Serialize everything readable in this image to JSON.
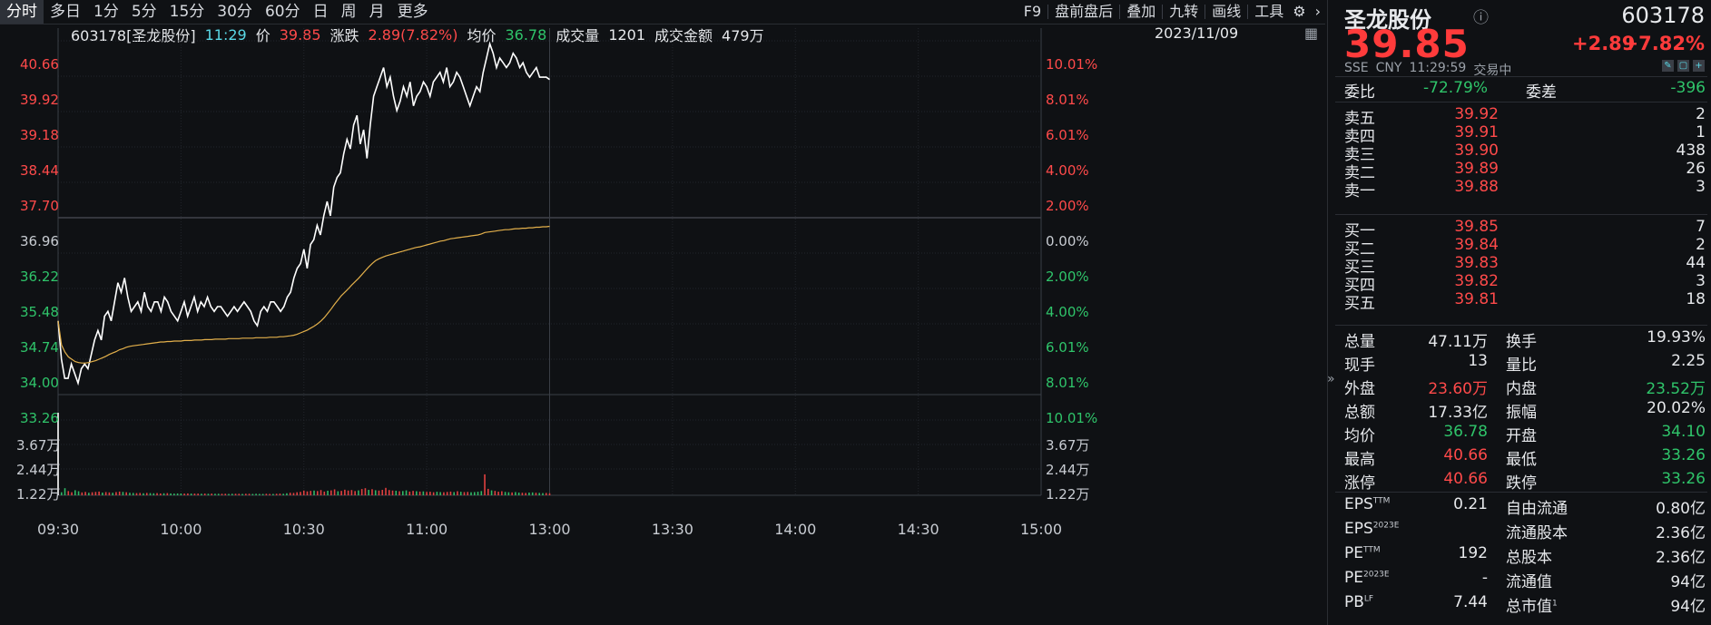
{
  "toolbar": {
    "periods": [
      "分时",
      "多日",
      "1分",
      "5分",
      "15分",
      "30分",
      "60分",
      "日",
      "周",
      "月",
      "更多"
    ],
    "active": "分时",
    "right_items": [
      "F9",
      "盘前盘后",
      "叠加",
      "九转",
      "画线",
      "工具"
    ],
    "settings_icon": "gear-icon",
    "more_icon": "chevron-right-icon"
  },
  "info": {
    "code_name": "603178[圣龙股份]",
    "time": "11:29",
    "price_label": "价",
    "price": "39.85",
    "change_label": "涨跌",
    "change": "2.89(7.82%)",
    "avg_label": "均价",
    "avg": "36.78",
    "vol_label": "成交量",
    "vol": "1201",
    "amount_label": "成交金额",
    "amount": "479万",
    "date": "2023/11/09"
  },
  "chart_data": {
    "type": "line",
    "prev_close": 36.96,
    "ylim": [
      33.26,
      40.66
    ],
    "y_ticks": [
      "40.66",
      "39.92",
      "39.18",
      "38.44",
      "37.70",
      "36.96",
      "36.22",
      "35.48",
      "34.74",
      "34.00",
      "33.26"
    ],
    "pct_ticks": [
      "10.01%",
      "8.01%",
      "6.01%",
      "4.00%",
      "2.00%",
      "0.00%",
      "2.00%",
      "4.00%",
      "6.01%",
      "8.01%",
      "10.01%"
    ],
    "x_ticks": [
      "09:30",
      "10:00",
      "10:30",
      "11:00",
      "13:00",
      "13:30",
      "14:00",
      "14:30",
      "15:00"
    ],
    "vol_ticks": [
      "3.67万",
      "2.44万",
      "1.22万"
    ],
    "vol_max": 48900,
    "series": [
      {
        "color": "#ffffff",
        "values": [
          34.8,
          34.0,
          33.6,
          33.6,
          33.9,
          33.7,
          33.5,
          33.8,
          33.9,
          33.8,
          34.1,
          34.4,
          34.6,
          34.4,
          34.9,
          35.0,
          34.8,
          35.2,
          35.6,
          35.4,
          35.7,
          35.3,
          35.0,
          35.1,
          35.2,
          35.0,
          35.4,
          35.1,
          35.0,
          35.2,
          35.2,
          35.0,
          35.3,
          35.2,
          35.0,
          34.9,
          34.8,
          35.0,
          35.2,
          34.9,
          35.1,
          35.3,
          35.0,
          35.2,
          35.1,
          35.3,
          35.1,
          35.0,
          35.1,
          35.1,
          35.0,
          34.9,
          35.0,
          35.1,
          35.0,
          35.1,
          35.2,
          35.1,
          35.0,
          34.8,
          34.7,
          35.0,
          35.1,
          35.0,
          35.2,
          35.2,
          35.1,
          35.0,
          35.1,
          35.3,
          35.4,
          35.7,
          35.9,
          36.0,
          36.3,
          35.9,
          36.4,
          36.5,
          36.8,
          36.6,
          37.0,
          37.3,
          37.0,
          37.6,
          37.8,
          37.9,
          38.3,
          38.6,
          38.4,
          38.9,
          39.1,
          38.5,
          38.8,
          38.2,
          38.9,
          39.5,
          39.7,
          39.9,
          40.1,
          39.7,
          39.9,
          39.5,
          39.2,
          39.4,
          39.7,
          39.5,
          39.8,
          39.3,
          39.5,
          39.6,
          39.8,
          39.7,
          39.5,
          39.8,
          39.9,
          40.0,
          39.8,
          40.1,
          39.7,
          39.8,
          40.0,
          39.9,
          39.7,
          39.5,
          39.3,
          39.5,
          39.7,
          39.6,
          40.0,
          40.3,
          40.6,
          40.4,
          40.1,
          40.3,
          40.2,
          40.1,
          40.2,
          40.4,
          40.3,
          40.1,
          40.2,
          40.0,
          39.9,
          40.0,
          40.1,
          39.9,
          39.9,
          39.9,
          39.85
        ]
      },
      {
        "color": "#e3b04b",
        "values": [
          34.8,
          34.3,
          34.15,
          34.05,
          34.0,
          33.95,
          33.93,
          33.92,
          33.92,
          33.93,
          33.95,
          33.97,
          34.0,
          34.03,
          34.06,
          34.1,
          34.13,
          34.16,
          34.2,
          34.22,
          34.25,
          34.27,
          34.28,
          34.29,
          34.3,
          34.31,
          34.32,
          34.33,
          34.34,
          34.35,
          34.36,
          34.36,
          34.37,
          34.37,
          34.38,
          34.38,
          34.38,
          34.39,
          34.39,
          34.39,
          34.4,
          34.4,
          34.4,
          34.41,
          34.41,
          34.41,
          34.42,
          34.42,
          34.42,
          34.42,
          34.43,
          34.43,
          34.43,
          34.43,
          34.44,
          34.44,
          34.44,
          34.44,
          34.45,
          34.45,
          34.45,
          34.45,
          34.46,
          34.46,
          34.46,
          34.47,
          34.47,
          34.48,
          34.49,
          34.5,
          34.52,
          34.55,
          34.58,
          34.61,
          34.65,
          34.69,
          34.74,
          34.8,
          34.87,
          34.96,
          35.05,
          35.15,
          35.24,
          35.33,
          35.4,
          35.47,
          35.55,
          35.62,
          35.69,
          35.77,
          35.85,
          35.93,
          36.0,
          36.06,
          36.1,
          36.13,
          36.16,
          36.18,
          36.2,
          36.22,
          36.24,
          36.26,
          36.28,
          36.3,
          36.32,
          36.34,
          36.35,
          36.37,
          36.39,
          36.41,
          36.43,
          36.45,
          36.47,
          36.48,
          36.5,
          36.52,
          36.53,
          36.54,
          36.55,
          36.56,
          36.57,
          36.58,
          36.59,
          36.6,
          36.62,
          36.65,
          36.66,
          36.67,
          36.68,
          36.69,
          36.7,
          36.71,
          36.71,
          36.72,
          36.73,
          36.73,
          36.74,
          36.74,
          36.75,
          36.75,
          36.76,
          36.76,
          36.77,
          36.77,
          36.78
        ]
      }
    ],
    "volume": [
      48900,
      1800,
      4200,
      2500,
      1800,
      3000,
      2400,
      1700,
      2000,
      1500,
      1800,
      2000,
      2200,
      1600,
      1900,
      1700,
      1500,
      1900,
      2200,
      2000,
      1800,
      1500,
      1400,
      1300,
      1400,
      1200,
      1400,
      1300,
      1200,
      1300,
      1100,
      1200,
      1300,
      1100,
      1000,
      1100,
      1100,
      1000,
      1100,
      1000,
      1000,
      1000,
      900,
      1000,
      900,
      1000,
      900,
      900,
      900,
      900,
      800,
      900,
      900,
      900,
      800,
      900,
      900,
      800,
      900,
      800,
      800,
      900,
      800,
      800,
      900,
      1000,
      900,
      1200,
      1500,
      1400,
      1800,
      2000,
      2800,
      2300,
      2600,
      2800,
      2500,
      3100,
      2200,
      2700,
      2900,
      3500,
      2400,
      2600,
      3300,
      2800,
      3100,
      2500,
      2900,
      3700,
      4200,
      3200,
      3600,
      3000,
      2800,
      3200,
      4400,
      3100,
      2800,
      2700,
      2400,
      2500,
      2900,
      2200,
      2600,
      2400,
      2200,
      2300,
      2000,
      2100,
      1800,
      2100,
      1900,
      1800,
      2000,
      2200,
      1900,
      2400,
      2100,
      1900,
      2000,
      1800,
      1900,
      2100,
      2500,
      12400,
      3800,
      2900,
      2600,
      2100,
      2400,
      2000,
      1800,
      1700,
      1900,
      1600,
      1500,
      1400,
      1600,
      1700,
      1500,
      1400,
      1300,
      1400,
      1201
    ]
  },
  "quote": {
    "name": "圣龙股份",
    "code": "603178",
    "price": "39.85",
    "change": "+2.89",
    "change_pct": "+7.82%",
    "exchange": "SSE",
    "currency": "CNY",
    "time": "11:29:59",
    "status": "交易中",
    "weibi_label": "委比",
    "weibi": "-72.79%",
    "weicha_label": "委差",
    "weicha": "-396",
    "sells": [
      {
        "label": "卖五",
        "price": "39.92",
        "vol": "2"
      },
      {
        "label": "卖四",
        "price": "39.91",
        "vol": "1"
      },
      {
        "label": "卖三",
        "price": "39.90",
        "vol": "438"
      },
      {
        "label": "卖二",
        "price": "39.89",
        "vol": "26"
      },
      {
        "label": "卖一",
        "price": "39.88",
        "vol": "3"
      }
    ],
    "buys": [
      {
        "label": "买一",
        "price": "39.85",
        "vol": "7"
      },
      {
        "label": "买二",
        "price": "39.84",
        "vol": "2"
      },
      {
        "label": "买三",
        "price": "39.83",
        "vol": "44"
      },
      {
        "label": "买四",
        "price": "39.82",
        "vol": "3"
      },
      {
        "label": "买五",
        "price": "39.81",
        "vol": "18"
      }
    ],
    "stats": [
      {
        "l1": "总量",
        "v1": "47.11万",
        "c1": "white",
        "l2": "换手",
        "v2": "19.93%",
        "c2": "white"
      },
      {
        "l1": "现手",
        "v1": "13",
        "c1": "white",
        "l2": "量比",
        "v2": "2.25",
        "c2": "white"
      },
      {
        "l1": "外盘",
        "v1": "23.60万",
        "c1": "red",
        "l2": "内盘",
        "v2": "23.52万",
        "c2": "green"
      },
      {
        "l1": "总额",
        "v1": "17.33亿",
        "c1": "white",
        "l2": "振幅",
        "v2": "20.02%",
        "c2": "white"
      },
      {
        "l1": "均价",
        "v1": "36.78",
        "c1": "green",
        "l2": "开盘",
        "v2": "34.10",
        "c2": "green"
      },
      {
        "l1": "最高",
        "v1": "40.66",
        "c1": "red",
        "l2": "最低",
        "v2": "33.26",
        "c2": "green"
      },
      {
        "l1": "涨停",
        "v1": "40.66",
        "c1": "red",
        "l2": "跌停",
        "v2": "33.26",
        "c2": "green"
      }
    ],
    "fundamentals": [
      {
        "l1": "EPS",
        "s1": "TTM",
        "v1": "0.21",
        "l2": "自由流通",
        "s2": "",
        "v2": "0.80亿"
      },
      {
        "l1": "EPS",
        "s1": "2023E",
        "v1": "",
        "l2": "流通股本",
        "s2": "",
        "v2": "2.36亿"
      },
      {
        "l1": "PE",
        "s1": "TTM",
        "v1": "192",
        "l2": "总股本",
        "s2": "",
        "v2": "2.36亿"
      },
      {
        "l1": "PE",
        "s1": "2023E",
        "v1": "-",
        "l2": "流通值",
        "s2": "",
        "v2": "94亿"
      },
      {
        "l1": "PB",
        "s1": "LF",
        "v1": "7.44",
        "l2": "总市值",
        "s2": "1",
        "v2": "94亿"
      }
    ]
  }
}
